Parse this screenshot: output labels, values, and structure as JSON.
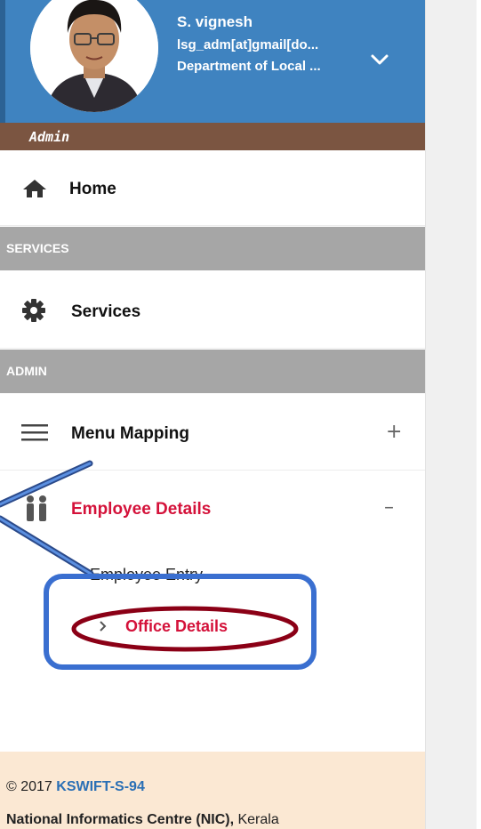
{
  "profile": {
    "name": "S. vignesh",
    "email": "lsg_adm[at]gmail[do...",
    "department": "Department of Local ...",
    "role": "Admin"
  },
  "nav": {
    "home_label": "Home",
    "services_section": "SERVICES",
    "services_label": "Services",
    "admin_section": "ADMIN",
    "menu_mapping_label": "Menu Mapping",
    "menu_mapping_toggle": "+",
    "employee_details_label": "Employee Details",
    "employee_details_toggle": "–",
    "sub_items": {
      "employee_entry": "Employee Entry",
      "office_details": "Office Details"
    }
  },
  "footer": {
    "copyright": "© 2017 ",
    "brand": "KSWIFT-S-94",
    "org": "National Informatics Centre (NIC),",
    "state": " Kerala"
  },
  "colors": {
    "header_blue": "#3f83c0",
    "role_brown": "#7b5541",
    "section_grey": "#a6a6a6",
    "active_red": "#d4123a",
    "footer_bg": "#fbe8d3",
    "annotation_blue": "#3a6fd0",
    "annotation_maroon": "#8b0016"
  },
  "icons": {
    "home": "home-icon",
    "services": "gear-icon",
    "menu_mapping": "hamburger-icon",
    "employee_details": "people-icon",
    "sub_item": "chevron-right-icon",
    "profile_toggle": "chevron-down-icon"
  }
}
